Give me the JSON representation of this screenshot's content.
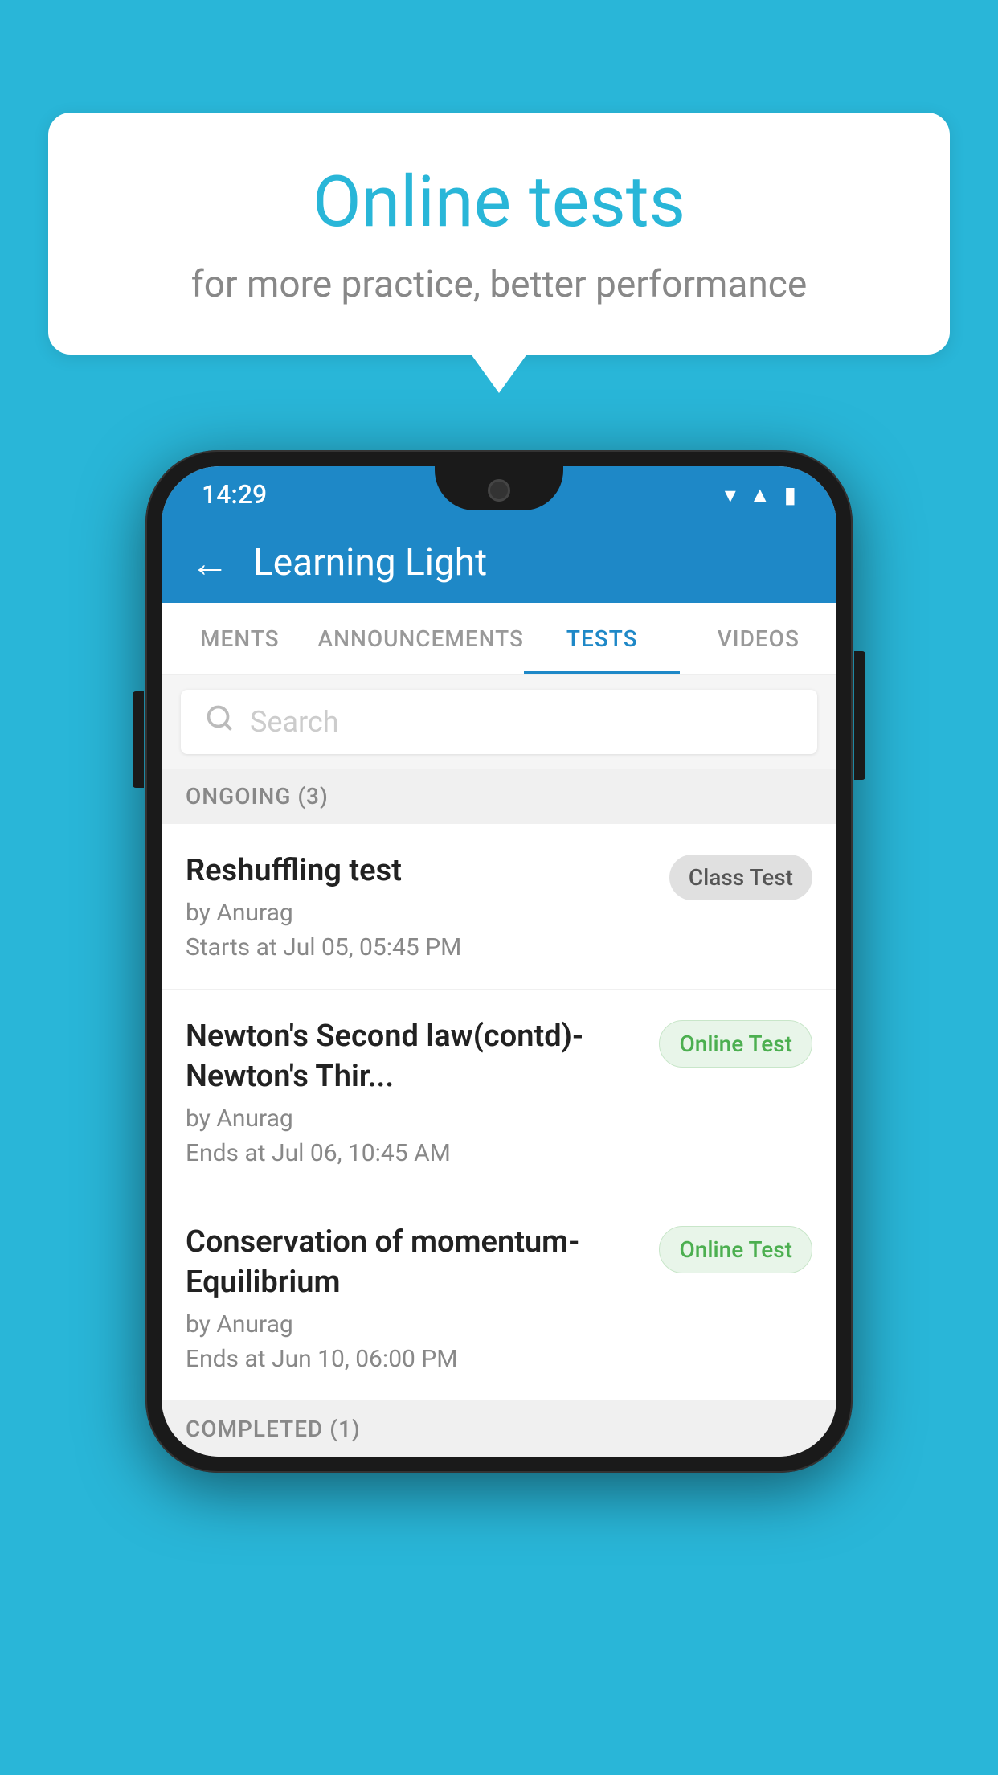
{
  "background": {
    "color": "#29b6d8"
  },
  "speech_bubble": {
    "title": "Online tests",
    "subtitle": "for more practice, better performance"
  },
  "phone": {
    "status_bar": {
      "time": "14:29",
      "wifi": "▼",
      "signal": "▲",
      "battery": "▮"
    },
    "app_bar": {
      "back_label": "←",
      "title": "Learning Light"
    },
    "tabs": [
      {
        "label": "MENTS",
        "active": false
      },
      {
        "label": "ANNOUNCEMENTS",
        "active": false
      },
      {
        "label": "TESTS",
        "active": true
      },
      {
        "label": "VIDEOS",
        "active": false
      }
    ],
    "search": {
      "placeholder": "Search"
    },
    "ongoing_section": {
      "label": "ONGOING (3)",
      "items": [
        {
          "title": "Reshuffling test",
          "author": "by Anurag",
          "date": "Starts at  Jul 05, 05:45 PM",
          "badge": "Class Test",
          "badge_type": "class"
        },
        {
          "title": "Newton's Second law(contd)-Newton's Thir...",
          "author": "by Anurag",
          "date": "Ends at  Jul 06, 10:45 AM",
          "badge": "Online Test",
          "badge_type": "online"
        },
        {
          "title": "Conservation of momentum-Equilibrium",
          "author": "by Anurag",
          "date": "Ends at  Jun 10, 06:00 PM",
          "badge": "Online Test",
          "badge_type": "online"
        }
      ]
    },
    "completed_section": {
      "label": "COMPLETED (1)"
    }
  }
}
